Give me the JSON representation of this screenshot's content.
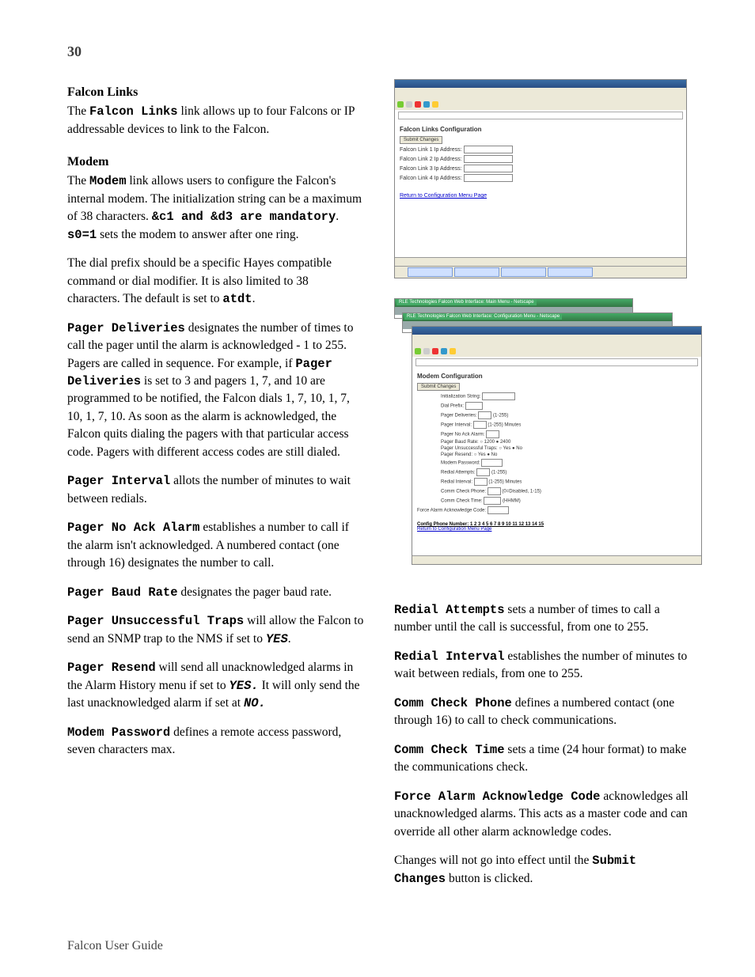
{
  "page_number": "30",
  "footer": "Falcon User Guide",
  "sec_falcon_links": {
    "heading": "Falcon Links",
    "p1a": "The ",
    "p1b": "Falcon Links",
    "p1c": " link allows up to four Falcons or IP addressable devices to link to the Falcon."
  },
  "sec_modem": {
    "heading": "Modem",
    "p1a": "The ",
    "p1b": "Modem",
    "p1c": " link allows users to configure the Falcon's internal modem.  The initialization string can be a maximum of 38 characters.  ",
    "p1d": "&c1 and &d3 are mandatory",
    "p1e": ".  ",
    "p1f": "s0=1",
    "p1g": " sets the modem to answer after one ring.",
    "p2a": "The dial prefix should be a specific Hayes compatible command or dial modifier.  It is also limited to 38 characters.  The default is set to ",
    "p2b": "atdt",
    "p2c": ".",
    "p3a": "Pager Deliveries",
    "p3b": " designates the number of times to call the pager until the alarm is acknowledged - 1 to 255.  Pagers are called in sequence.  For example, if ",
    "p3c": "Pager Deliveries",
    "p3d": " is set to 3 and pagers 1, 7, and 10 are programmed to be notified, the Falcon dials 1, 7, 10, 1, 7, 10, 1, 7, 10.  As soon as the alarm is acknowledged, the Falcon quits dialing the pagers with that particular access code.  Pagers with different access codes are still dialed.",
    "p4a": "Pager Interval",
    "p4b": " allots the number of minutes to wait between redials.",
    "p5a": "Pager No Ack Alarm",
    "p5b": " establishes a number to call if the alarm isn't acknowledged.  A numbered contact (one through 16) designates the number to call.",
    "p6a": "Pager Baud Rate",
    "p6b": " designates the pager baud rate.",
    "p7a": "Pager Unsuccessful Traps",
    "p7b": " will allow the Falcon to send an SNMP trap to the NMS if set to ",
    "p7c": "YES",
    "p7d": ".",
    "p8a": "Pager Resend",
    "p8b": " will send all unacknowledged alarms in the Alarm History menu if set to ",
    "p8c": "YES.",
    "p8d": "  It will only send the last unacknowledged alarm if set at ",
    "p8e": "NO.",
    "p9a": "Modem Password",
    "p9b": " defines a remote access password, seven characters max."
  },
  "right": {
    "p1a": "Redial Attempts",
    "p1b": " sets a number of times to call a number until the call is successful, from one to 255.",
    "p2a": "Redial Interval",
    "p2b": " establishes the number of minutes to wait between redials, from one to 255.",
    "p3a": "Comm Check Phone",
    "p3b": " defines a numbered contact (one through 16) to call to check communications.",
    "p4a": "Comm Check Time",
    "p4b": " sets a time (24 hour format) to make the communications check.",
    "p5a": "Force Alarm Acknowledge Code",
    "p5b": " acknowledges all unacknowledged alarms.  This acts as a master code and can override all other alarm acknowledge codes.",
    "p6a": "Changes will not go into effect until the ",
    "p6b": "Submit Changes",
    "p6c": " button is clicked."
  },
  "fig1": {
    "title": "Falcon Links Configuration",
    "submit": "Submit Changes",
    "rows": [
      "Falcon Link 1 Ip Address:",
      "Falcon Link 2 Ip Address:",
      "Falcon Link 3 Ip Address:",
      "Falcon Link 4 Ip Address:"
    ],
    "return": "Return to Configuration Menu Page"
  },
  "fig2": {
    "window1": "RLE Technologies Falcon Web Interface: Main Menu - Netscape",
    "window2": "RLE Technologies Falcon Web Interface: Configuration Menu - Netscape",
    "title": "Modem Configuration",
    "submit": "Submit Changes",
    "rows": [
      "Initialization String:",
      "Dial Prefix:",
      "Pager Deliveries:",
      "Pager Interval:",
      "Pager No Ack Alarm:",
      "Pager Baud Rate:",
      "Pager Unsuccessful Traps:",
      "Pager Resend:",
      "Modem Password:",
      "Redial Attempts:",
      "Redial Interval:",
      "Comm Check Phone:",
      "Comm Check Time:",
      "Force Alarm Acknowledge Code:"
    ],
    "ranges": [
      "(1-255)",
      "(1-255) Minutes",
      "",
      "",
      "",
      "",
      "(1-255)",
      "(1-255) Minutes",
      "(0=Disabled, 1-15)",
      "(HHMM)"
    ],
    "config_nums": "Config Phone Number:  1  2  3  4  5  6  7  8  9  10  11  12  13  14  15",
    "return": "Return to Configuration Menu Page"
  }
}
